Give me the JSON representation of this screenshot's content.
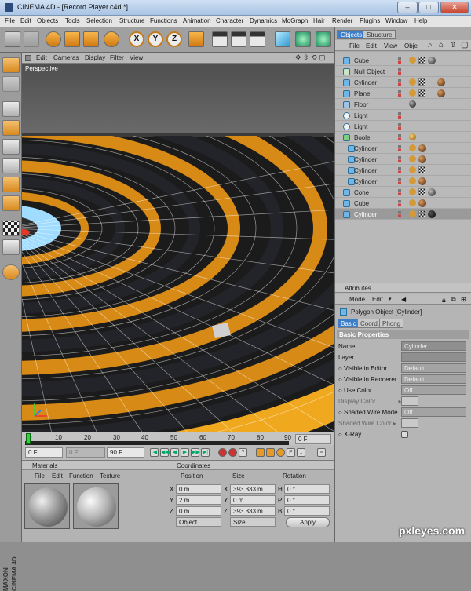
{
  "window": {
    "title": "CINEMA 4D - [Record Player.c4d *]",
    "min": "–",
    "max": "□",
    "close": "✕"
  },
  "menubar": [
    "File",
    "Edit",
    "Objects",
    "Tools",
    "Selection",
    "Structure",
    "Functions",
    "Animation",
    "Character",
    "Dynamics",
    "MoGraph",
    "Hair",
    "Render",
    "Plugins",
    "Window",
    "Help"
  ],
  "toolbar": {
    "axis_labels": [
      "X",
      "Y",
      "Z"
    ]
  },
  "viewport": {
    "menu": [
      "Edit",
      "Cameras",
      "Display",
      "Filter",
      "View"
    ],
    "label": "Perspective",
    "controls": "✥ ⇳ ⟲ ▢"
  },
  "timeline": {
    "ticks": [
      "0",
      "10",
      "20",
      "30",
      "40",
      "50",
      "60",
      "70",
      "80",
      "90"
    ],
    "frame": "0 F"
  },
  "transport": {
    "start": "0 F",
    "range": "0 F",
    "end": "90 F"
  },
  "materials": {
    "title": "Materials",
    "menu": [
      "File",
      "Edit",
      "Function",
      "Texture"
    ]
  },
  "coordinates": {
    "title": "Coordinates",
    "headers": [
      "Position",
      "Size",
      "Rotation"
    ],
    "rows": [
      {
        "axis": "X",
        "pos": "0 m",
        "saxis": "X",
        "size": "393.333 m",
        "raxis": "H",
        "rot": "0 °"
      },
      {
        "axis": "Y",
        "pos": "2 m",
        "saxis": "Y",
        "size": "0 m",
        "raxis": "P",
        "rot": "0 °"
      },
      {
        "axis": "Z",
        "pos": "0 m",
        "saxis": "Z",
        "size": "393.333 m",
        "raxis": "B",
        "rot": "0 °"
      }
    ],
    "mode": "Object",
    "size_mode": "Size",
    "apply": "Apply"
  },
  "objects_panel": {
    "tabs": [
      "Objects",
      "Structure"
    ],
    "menu": [
      "File",
      "Edit",
      "View",
      "Obje"
    ],
    "items": [
      "Cube",
      "Null Object",
      "Cylinder",
      "Plane",
      "Floor",
      "Light",
      "Light",
      "Boole",
      "Cylinder",
      "Cylinder",
      "Cylinder",
      "Cylinder",
      "Cone",
      "Cube",
      "Cylinder"
    ]
  },
  "attributes": {
    "title": "Attributes",
    "menu": [
      "Mode",
      "Edit"
    ],
    "object": "Polygon Object [Cylinder]",
    "tabs": [
      "Basic",
      "Coord.",
      "Phong"
    ],
    "section": "Basic Properties",
    "props": [
      {
        "label": "Name . . . . . . . . . . . .",
        "value": "Cylinder"
      },
      {
        "label": "Layer . . . . . . . . . . . .",
        "value": ""
      },
      {
        "label": "○ Visible in Editor . . . . .",
        "value": "Default"
      },
      {
        "label": "○ Visible in Renderer . . .",
        "value": "Default"
      },
      {
        "label": "○ Use Color . . . . . . . . .",
        "value": "Off"
      },
      {
        "label": "Display Color . . . . . . ▸",
        "value": ""
      },
      {
        "label": "○ Shaded Wire Mode",
        "value": "Off"
      },
      {
        "label": "Shaded Wire Color ▸",
        "value": ""
      },
      {
        "label": "○ X-Ray . . . . . . . . . . .",
        "value": ""
      }
    ]
  },
  "watermark": "pxleyes.com"
}
